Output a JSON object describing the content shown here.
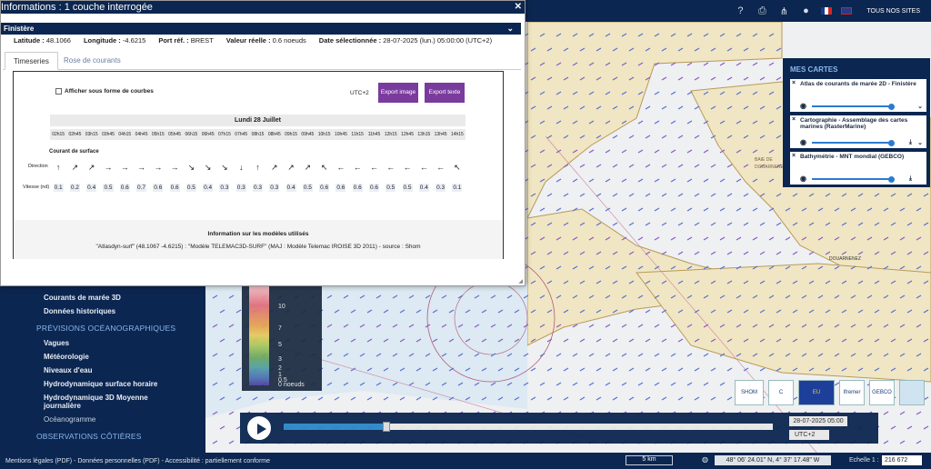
{
  "popup": {
    "title": "Informations : 1 couche interrogée",
    "region": "Finistère",
    "info": {
      "lat_label": "Latitude :",
      "lat": "48.1066",
      "lon_label": "Longitude :",
      "lon": "-4.6215",
      "port_label": "Port réf. :",
      "port": "BREST",
      "val_label": "Valeur réelle :",
      "val": "0.6 noeuds",
      "date_label": "Date sélectionnée :",
      "date": "28-07-2025 (lun.) 05:00:00 (UTC+2)"
    },
    "tabs": [
      "Timeseries",
      "Rose de courants"
    ],
    "checkbox_label": "Afficher sous forme de courbes",
    "utc": "UTC+2",
    "export_image": "Export image",
    "export_text": "Export texte",
    "day": "Lundi 28 Juillet",
    "hours": [
      "02h15",
      "02h45",
      "03h15",
      "03h45",
      "04h15",
      "04h45",
      "05h15",
      "05h45",
      "06h15",
      "06h45",
      "07h15",
      "07h45",
      "08h15",
      "08h45",
      "09h15",
      "09h45",
      "10h15",
      "10h45",
      "11h15",
      "11h45",
      "12h15",
      "12h45",
      "13h15",
      "13h45",
      "14h15"
    ],
    "surface_label": "Courant de surface",
    "direction_label": "Direction",
    "speed_label": "Vitesse (nd)",
    "directions": [
      "↑",
      "↗",
      "↗",
      "→",
      "→",
      "→",
      "→",
      "→",
      "↘",
      "↘",
      "↘",
      "↓",
      "↑",
      "↗",
      "↗",
      "↗",
      "↖",
      "←",
      "←",
      "←",
      "←",
      "←",
      "←",
      "←",
      "↖"
    ],
    "speeds": [
      "0.1",
      "0.2",
      "0.4",
      "0.5",
      "0.6",
      "0.7",
      "0.6",
      "0.6",
      "0.5",
      "0.4",
      "0.3",
      "0.3",
      "0.3",
      "0.3",
      "0.4",
      "0.5",
      "0.6",
      "0.6",
      "0.6",
      "0.6",
      "0.5",
      "0.5",
      "0.4",
      "0.3",
      "0.1"
    ],
    "models_title": "Information sur les modèles utilisés",
    "models_text": "\"Atlasdyn-surf\" (48.1067 -4.6215) : \"Modèle TELEMAC3D-SURF\" (MAJ : Modèle Telemac IROISE 3D 2011) - source : Shom"
  },
  "topbar": {
    "sites": "TOUS NOS SITES",
    "icons": [
      "help-icon",
      "print-icon",
      "share-icon",
      "user-icon"
    ]
  },
  "cartes": {
    "title": "MES CARTES",
    "items": [
      "Atlas de courants de marée 2D - Finistère",
      "Cartographie - Assemblage des cartes marines (RasterMarine)",
      "Bathymétrie - MNT mondial (GEBCO)"
    ]
  },
  "nav": {
    "items1": [
      "Courants de marée 3D",
      "Données historiques"
    ],
    "sec1": "PRÉVISIONS OCÉANOGRAPHIQUES",
    "items2": [
      "Vagues",
      "Météorologie",
      "Niveaux d'eau",
      "Hydrodynamique surface horaire",
      "Hydrodynamique 3D Moyenne journalière"
    ],
    "sub": "Océanogramme",
    "sec2": "OBSERVATIONS CÔTIÈRES"
  },
  "legend": {
    "labels": [
      "10",
      "7",
      "5",
      "3",
      "2",
      "1",
      "0.5",
      "0 noeuds"
    ]
  },
  "player": {
    "date": "28-07-2025 05:00",
    "tz": "UTC+2",
    "progress": 0.21
  },
  "logos": [
    "SHOM",
    "C",
    "EU",
    "Ifremer",
    "GEBCO",
    ""
  ],
  "footer": {
    "links": "Mentions légales (PDF) - Données personnelles (PDF) - Accessibilité : partiellement conforme",
    "scale": "5 km",
    "coord": "48° 06' 24.01\" N, 4° 37' 17.48\" W",
    "echelle_label": "Echelle 1 :",
    "echelle": "216 672"
  },
  "map_labels": [
    "DOUARNENEZ",
    "BAIE DE DOUARNENEZ"
  ],
  "colors": {
    "navy": "#0b2650",
    "accent": "#7a3b9e",
    "blue": "#2a7bd0"
  }
}
